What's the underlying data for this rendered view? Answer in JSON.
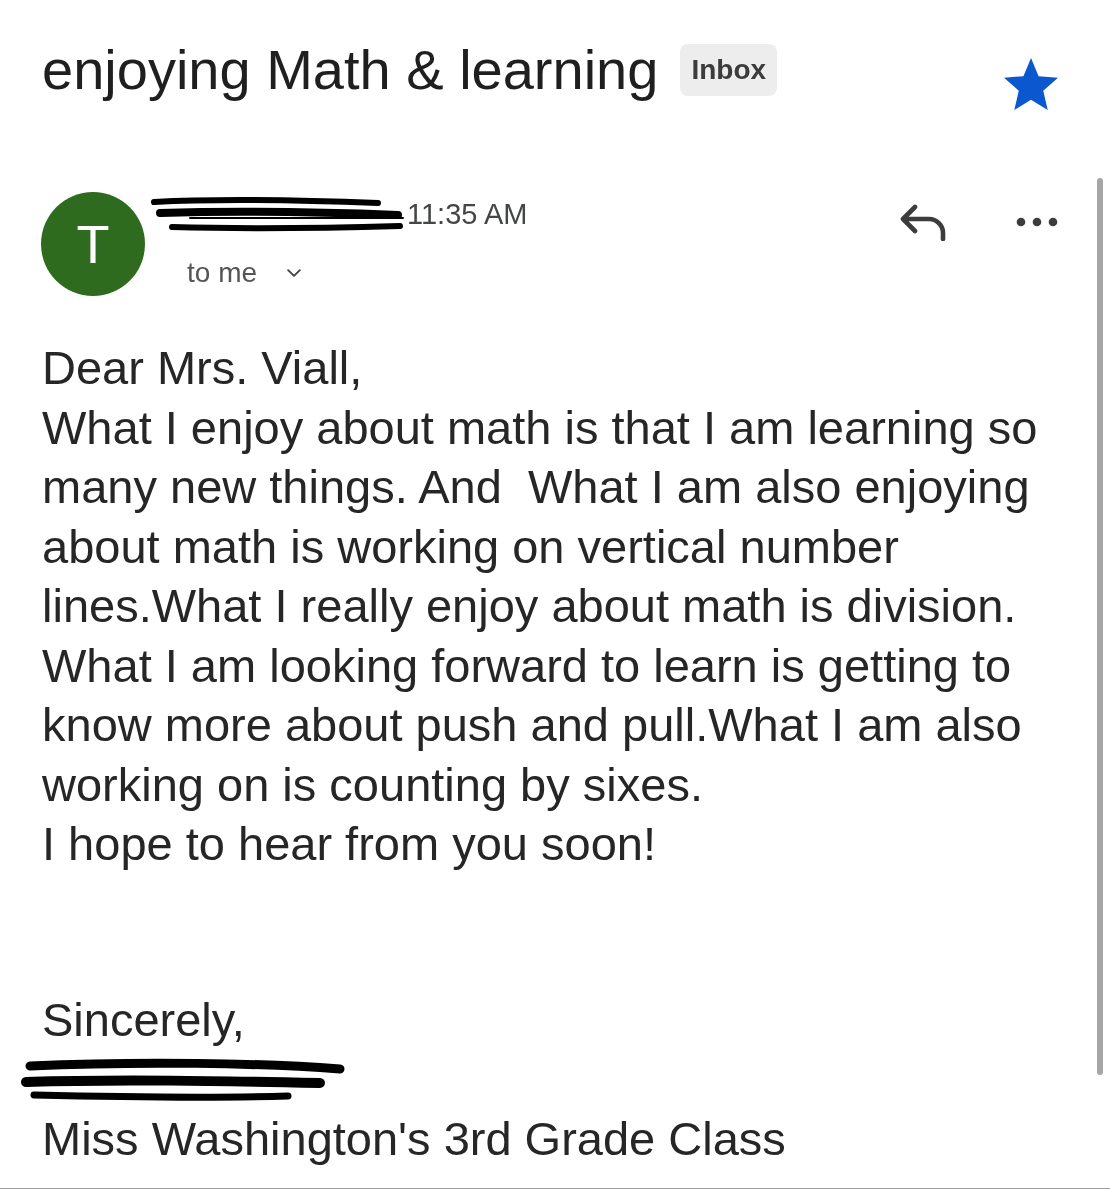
{
  "header": {
    "subject": "enjoying Math & learning",
    "label": "Inbox",
    "starred": true
  },
  "message": {
    "avatar_letter": "T",
    "sender_name_redacted": true,
    "time": "11:35 AM",
    "recipient": "to me"
  },
  "body": {
    "greeting": "Dear Mrs. Viall,",
    "text": "What I enjoy about math is that I am learning so many new things. And  What I am also enjoying about math is working on vertical number lines.What I really enjoy about math is division. What I am looking forward to learn is getting to know more about push and pull.What I am also working on is counting by sixes.",
    "closing": "I hope to hear from you soon!",
    "sign_off": "Sincerely,",
    "signature_redacted": true,
    "signature": "Miss Washington's 3rd Grade Class"
  }
}
